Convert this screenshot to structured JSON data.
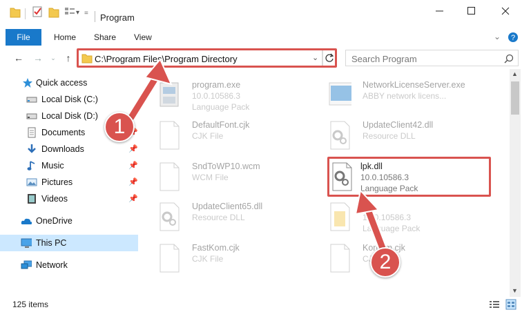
{
  "window": {
    "title": "Program"
  },
  "ribbon": {
    "file": "File",
    "home": "Home",
    "share": "Share",
    "view": "View"
  },
  "address": {
    "path": "C:\\Program Files\\Program Directory"
  },
  "search": {
    "placeholder": "Search Program"
  },
  "nav_pane": {
    "quick_access": "Quick access",
    "items": [
      {
        "label": "Local Disk (C:)",
        "icon": "drive-icon"
      },
      {
        "label": "Local Disk (D:)",
        "icon": "drive-icon"
      },
      {
        "label": "Documents",
        "icon": "documents-icon"
      },
      {
        "label": "Downloads",
        "icon": "downloads-icon"
      },
      {
        "label": "Music",
        "icon": "music-icon"
      },
      {
        "label": "Pictures",
        "icon": "pictures-icon"
      },
      {
        "label": "Videos",
        "icon": "videos-icon"
      }
    ],
    "onedrive": "OneDrive",
    "this_pc": "This PC",
    "network": "Network"
  },
  "files": [
    {
      "name": "program.exe",
      "l2": "10.0.10586.3",
      "l3": "Language Pack"
    },
    {
      "name": "NetworkLicenseServer.exe",
      "l2": "ABBY network licens...",
      "l3": ""
    },
    {
      "name": "DefaultFont.cjk",
      "l2": "CJK File",
      "l3": ""
    },
    {
      "name": "UpdateClient42.dll",
      "l2": "Resource DLL",
      "l3": ""
    },
    {
      "name": "SndToWP10.wcm",
      "l2": "WCM File",
      "l3": ""
    },
    {
      "name": "lpk.dll",
      "l2": "10.0.10586.3",
      "l3": "Language Pack"
    },
    {
      "name": "UpdateClient65.dll",
      "l2": "Resource DLL",
      "l3": ""
    },
    {
      "name": "",
      "l2": "10.0.10586.3",
      "l3": "Language Pack"
    },
    {
      "name": "FastKom.cjk",
      "l2": "CJK File",
      "l3": ""
    },
    {
      "name": "Korcom.cjk",
      "l2": "CJK File",
      "l3": ""
    }
  ],
  "status": {
    "items": "125 items"
  },
  "annotations": {
    "step1": "1",
    "step2": "2"
  },
  "colors": {
    "accent": "#1979ca",
    "highlight": "#d9534f",
    "selected": "#cce8ff"
  }
}
